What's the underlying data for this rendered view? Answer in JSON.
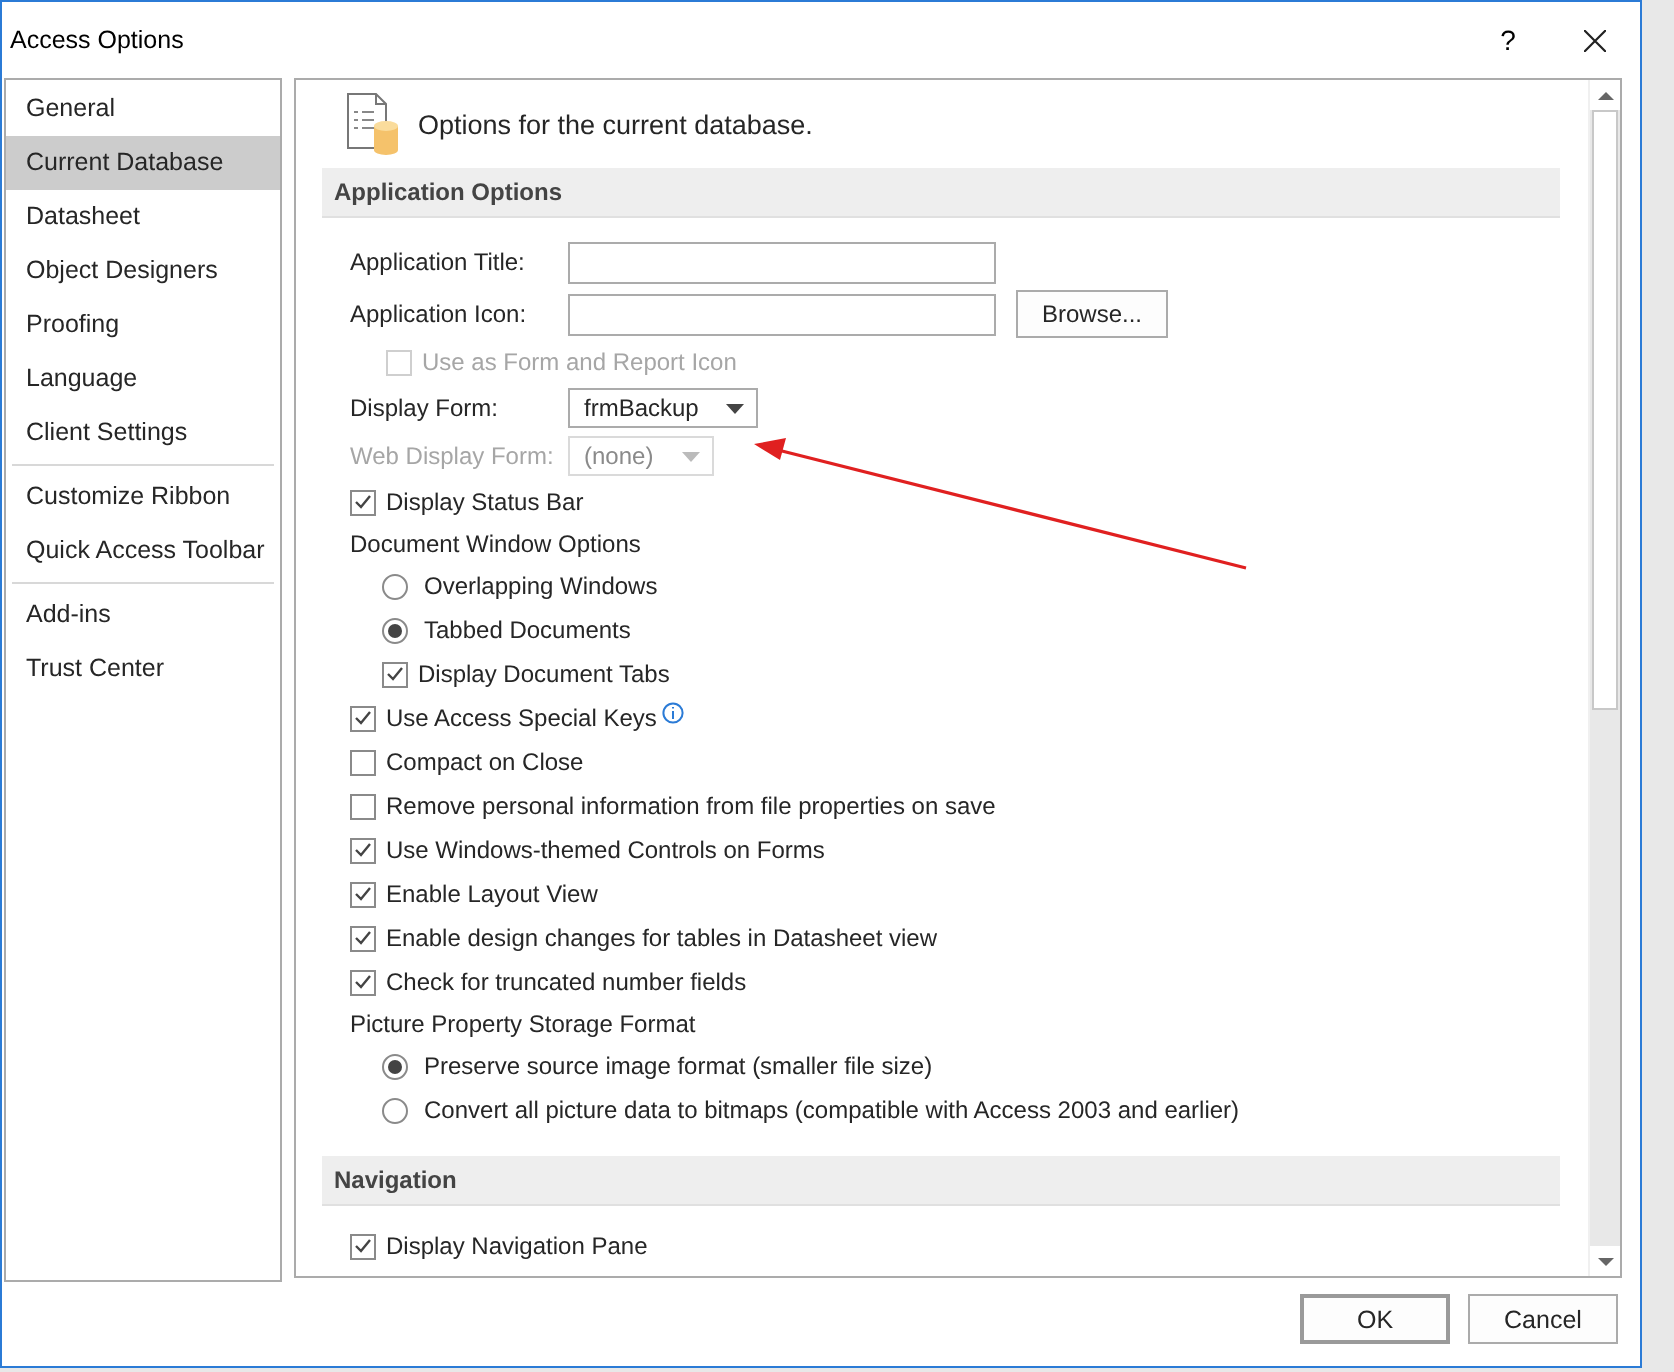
{
  "window": {
    "title": "Access Options",
    "help": "?"
  },
  "sidebar": {
    "groups": [
      {
        "items": [
          {
            "label": "General",
            "selected": false
          },
          {
            "label": "Current Database",
            "selected": true
          },
          {
            "label": "Datasheet",
            "selected": false
          },
          {
            "label": "Object Designers",
            "selected": false
          },
          {
            "label": "Proofing",
            "selected": false
          },
          {
            "label": "Language",
            "selected": false
          },
          {
            "label": "Client Settings",
            "selected": false
          }
        ]
      },
      {
        "items": [
          {
            "label": "Customize Ribbon",
            "selected": false
          },
          {
            "label": "Quick Access Toolbar",
            "selected": false
          }
        ]
      },
      {
        "items": [
          {
            "label": "Add-ins",
            "selected": false
          },
          {
            "label": "Trust Center",
            "selected": false
          }
        ]
      }
    ]
  },
  "page": {
    "heading": "Options for the current database."
  },
  "sections": [
    {
      "title": "Application Options",
      "items": [
        {
          "kind": "field",
          "label": "Application Title:"
        },
        {
          "kind": "field",
          "label": "Application Icon:",
          "button": "Browse...",
          "children": [
            {
              "kind": "checkbox",
              "label": "Use as Form and Report Icon",
              "checked": false,
              "disabled": true
            }
          ]
        },
        {
          "kind": "dropdown",
          "label": "Display Form:",
          "value": "frmBackup",
          "disabled": false
        },
        {
          "kind": "dropdown",
          "label": "Web Display Form:",
          "value": "(none)",
          "disabled": true
        },
        {
          "kind": "checkbox",
          "label": "Display Status Bar",
          "checked": true,
          "disabled": false
        },
        {
          "kind": "group",
          "label": "Document Window Options",
          "children": [
            {
              "kind": "radio",
              "label": "Overlapping Windows",
              "selected": false
            },
            {
              "kind": "radio",
              "label": "Tabbed Documents",
              "selected": true
            },
            {
              "kind": "checkbox",
              "label": "Display Document Tabs",
              "checked": true,
              "disabled": false
            }
          ]
        },
        {
          "kind": "checkbox",
          "label": "Use Access Special Keys",
          "checked": true,
          "disabled": false,
          "info": true
        },
        {
          "kind": "checkbox",
          "label": "Compact on Close",
          "checked": false,
          "disabled": false
        },
        {
          "kind": "checkbox",
          "label": "Remove personal information from file properties on save",
          "checked": false,
          "disabled": false
        },
        {
          "kind": "checkbox",
          "label": "Use Windows-themed Controls on Forms",
          "checked": true,
          "disabled": false
        },
        {
          "kind": "checkbox",
          "label": "Enable Layout View",
          "checked": true,
          "disabled": false
        },
        {
          "kind": "checkbox",
          "label": "Enable design changes for tables in Datasheet view",
          "checked": true,
          "disabled": false
        },
        {
          "kind": "checkbox",
          "label": "Check for truncated number fields",
          "checked": true,
          "disabled": false
        },
        {
          "kind": "group",
          "label": "Picture Property Storage Format",
          "children": [
            {
              "kind": "radio",
              "label": "Preserve source image format (smaller file size)",
              "selected": true
            },
            {
              "kind": "radio",
              "label": "Convert all picture data to bitmaps (compatible with Access 2003 and earlier)",
              "selected": false
            }
          ]
        }
      ]
    },
    {
      "title": "Navigation",
      "items": [
        {
          "kind": "checkbox",
          "label": "Display Navigation Pane",
          "checked": true,
          "disabled": false
        }
      ]
    }
  ],
  "buttons": [
    {
      "label": "OK",
      "default": true
    },
    {
      "label": "Cancel",
      "default": false
    }
  ]
}
